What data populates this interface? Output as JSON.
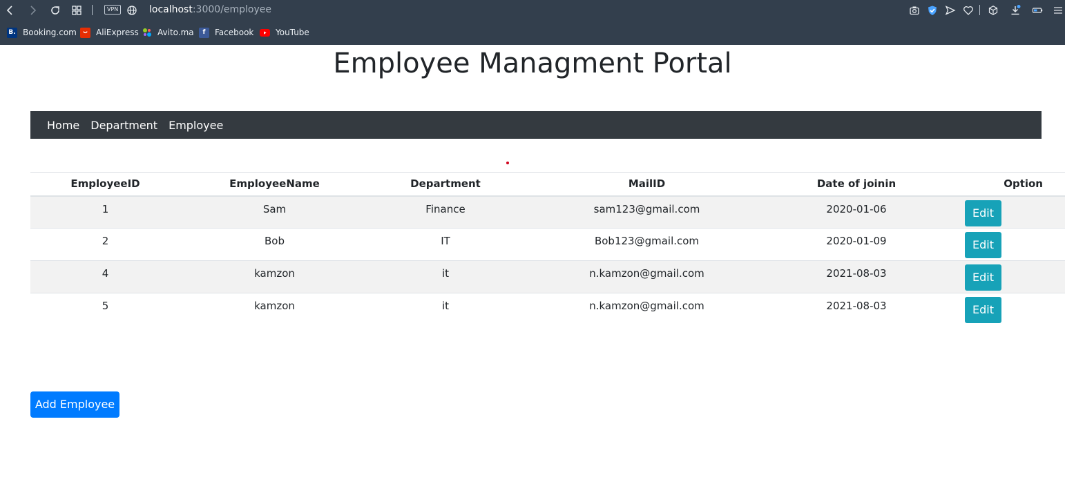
{
  "browser": {
    "vpn_label": "VPN",
    "url_host": "localhost",
    "url_path": ":3000/employee",
    "bookmarks": [
      {
        "label": "Booking.com",
        "icon": "booking-icon",
        "fav_text": "B.",
        "color": "#003580"
      },
      {
        "label": "AliExpress",
        "icon": "aliexpress-icon",
        "fav_text": "",
        "color": "#e62e04"
      },
      {
        "label": "Avito.ma",
        "icon": "avito-icon",
        "fav_text": "",
        "color": "#3bbf6b"
      },
      {
        "label": "Facebook",
        "icon": "facebook-icon",
        "fav_text": "f",
        "color": "#3b5998"
      },
      {
        "label": "YouTube",
        "icon": "youtube-icon",
        "fav_text": "",
        "color": "#ff0000"
      }
    ]
  },
  "page": {
    "title": "Employee Managment Portal"
  },
  "navbar": {
    "items": [
      "Home",
      "Department",
      "Employee"
    ]
  },
  "table": {
    "headers": [
      "EmployeeID",
      "EmployeeName",
      "Department",
      "MailID",
      "Date of joinin",
      "Option"
    ],
    "rows": [
      {
        "id": "1",
        "name": "Sam",
        "department": "Finance",
        "mail": "sam123@gmail.com",
        "date": "2020-01-06",
        "action": "Edit"
      },
      {
        "id": "2",
        "name": "Bob",
        "department": "IT",
        "mail": "Bob123@gmail.com",
        "date": "2020-01-09",
        "action": "Edit"
      },
      {
        "id": "4",
        "name": "kamzon",
        "department": "it",
        "mail": "n.kamzon@gmail.com",
        "date": "2021-08-03",
        "action": "Edit"
      },
      {
        "id": "5",
        "name": "kamzon",
        "department": "it",
        "mail": "n.kamzon@gmail.com",
        "date": "2021-08-03",
        "action": "Edit"
      }
    ]
  },
  "add_button_label": "Add Employee",
  "colors": {
    "navbar": "#343a40",
    "edit_button": "#17a2b8",
    "add_button": "#007bff",
    "browser_chrome": "#333f4d"
  }
}
